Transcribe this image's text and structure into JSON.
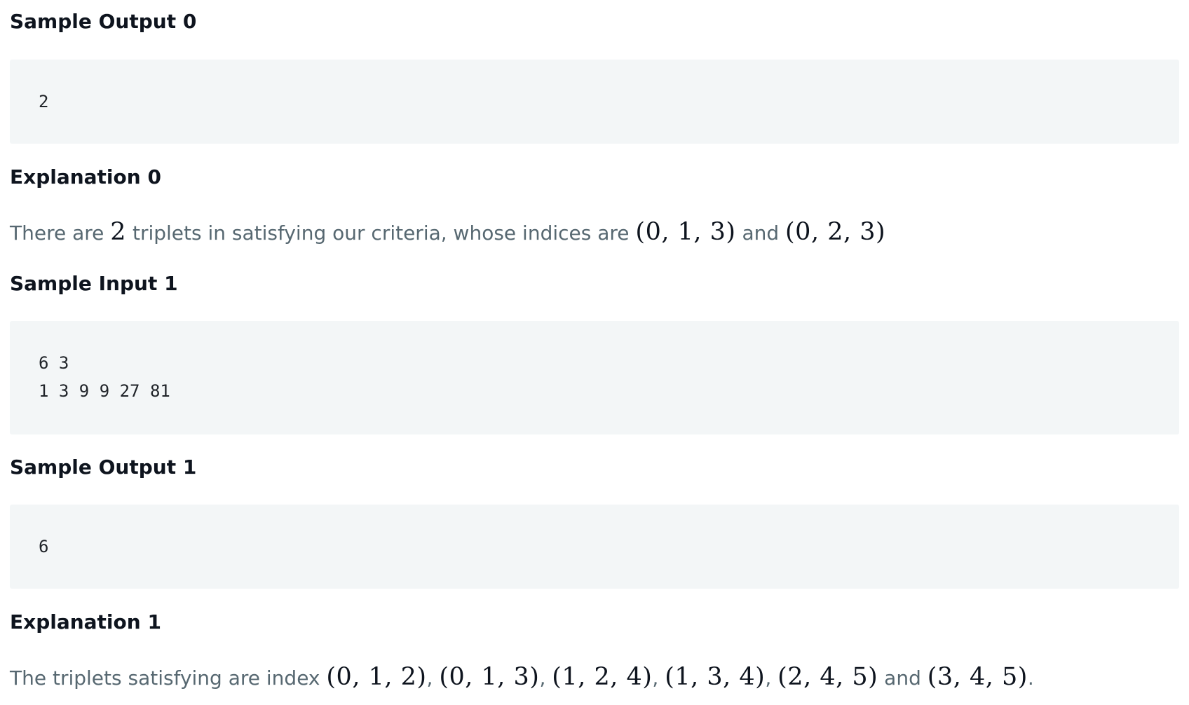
{
  "sample_output_0": {
    "heading": "Sample Output 0",
    "lines": [
      "2"
    ]
  },
  "explanation_0": {
    "heading": "Explanation 0",
    "t1": "There are ",
    "m1": "2",
    "t2": " triplets in satisfying our criteria, whose indices are ",
    "m2": "(0, 1, 3)",
    "t3": " and ",
    "m3": "(0, 2, 3)"
  },
  "sample_input_1": {
    "heading": "Sample Input 1",
    "lines": [
      "6 3",
      "1 3 9 9 27 81"
    ]
  },
  "sample_output_1": {
    "heading": "Sample Output 1",
    "lines": [
      "6"
    ]
  },
  "explanation_1": {
    "heading": "Explanation 1",
    "t1": "The triplets satisfying are index ",
    "m1": "(0, 1, 2)",
    "s1": ", ",
    "m2": "(0, 1, 3)",
    "s2": ", ",
    "m3": "(1, 2, 4)",
    "s3": ", ",
    "m4": "(1, 3, 4)",
    "s4": ", ",
    "m5": "(2, 4, 5)",
    "t2": " and ",
    "m6": "(3, 4, 5)",
    "t3": "."
  }
}
